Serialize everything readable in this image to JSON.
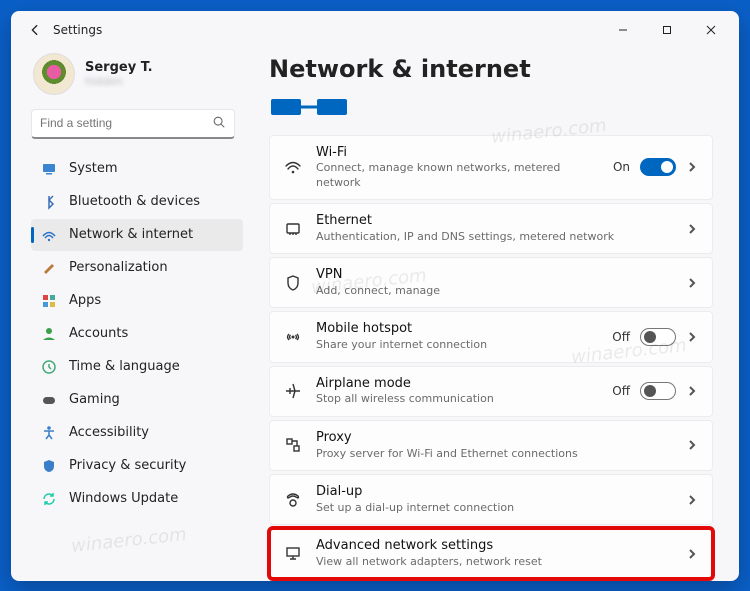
{
  "app": {
    "name": "Settings"
  },
  "user": {
    "name": "Sergey T.",
    "email": "hidden"
  },
  "search": {
    "placeholder": "Find a setting"
  },
  "sidebar": {
    "items": [
      {
        "label": "System"
      },
      {
        "label": "Bluetooth & devices"
      },
      {
        "label": "Network & internet"
      },
      {
        "label": "Personalization"
      },
      {
        "label": "Apps"
      },
      {
        "label": "Accounts"
      },
      {
        "label": "Time & language"
      },
      {
        "label": "Gaming"
      },
      {
        "label": "Accessibility"
      },
      {
        "label": "Privacy & security"
      },
      {
        "label": "Windows Update"
      }
    ]
  },
  "page": {
    "title": "Network & internet"
  },
  "cards": {
    "wifi": {
      "title": "Wi-Fi",
      "desc": "Connect, manage known networks, metered network",
      "state": "On"
    },
    "ethernet": {
      "title": "Ethernet",
      "desc": "Authentication, IP and DNS settings, metered network"
    },
    "vpn": {
      "title": "VPN",
      "desc": "Add, connect, manage"
    },
    "hotspot": {
      "title": "Mobile hotspot",
      "desc": "Share your internet connection",
      "state": "Off"
    },
    "airplane": {
      "title": "Airplane mode",
      "desc": "Stop all wireless communication",
      "state": "Off"
    },
    "proxy": {
      "title": "Proxy",
      "desc": "Proxy server for Wi-Fi and Ethernet connections"
    },
    "dialup": {
      "title": "Dial-up",
      "desc": "Set up a dial-up internet connection"
    },
    "advanced": {
      "title": "Advanced network settings",
      "desc": "View all network adapters, network reset"
    }
  },
  "watermark": "winaero.com"
}
